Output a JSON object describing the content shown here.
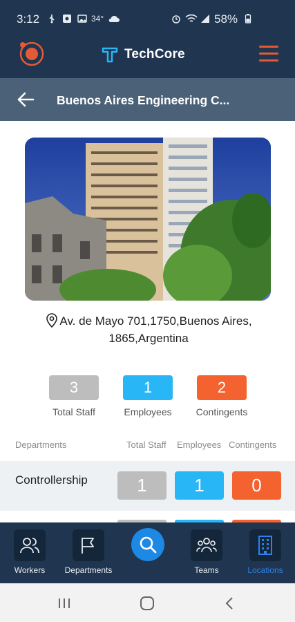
{
  "status_bar": {
    "time": "3:12",
    "temperature": "34°",
    "battery": "58%",
    "icons": [
      "usb-icon",
      "notification-icon",
      "image-icon",
      "cloud-icon",
      "alarm-icon",
      "wifi-icon",
      "signal-icon",
      "battery-icon"
    ]
  },
  "app": {
    "brand": "TechCore",
    "logo_icon": "orbit-logo-icon",
    "menu_icon": "hamburger-icon",
    "accent": "#e45a36",
    "navy": "#1f3550"
  },
  "header": {
    "back_icon": "arrow-left-icon",
    "title": "Buenos Aires Engineering C..."
  },
  "location": {
    "photo_alt": "building-photo",
    "address_line1": "Av. de Mayo 701,1750,Buenos Aires,",
    "address_line2": "1865,Argentina"
  },
  "summary": {
    "total_staff": {
      "value": "3",
      "label": "Total Staff",
      "color": "#bdbdbd"
    },
    "employees": {
      "value": "1",
      "label": "Employees",
      "color": "#29b6f6"
    },
    "contingents": {
      "value": "2",
      "label": "Contingents",
      "color": "#f4622f"
    }
  },
  "departments": {
    "headers": {
      "name": "Departments",
      "total": "Total Staff",
      "employees": "Employees",
      "contingents": "Contingents"
    },
    "rows": [
      {
        "name": "Controllership",
        "total": "1",
        "employees": "1",
        "contingents": "0"
      }
    ]
  },
  "bottom_nav": {
    "items": [
      {
        "label": "Workers",
        "icon": "people-icon"
      },
      {
        "label": "Departments",
        "icon": "flag-icon"
      },
      {
        "label": "",
        "icon": "search-icon"
      },
      {
        "label": "Teams",
        "icon": "team-icon"
      },
      {
        "label": "Locations",
        "icon": "building-icon",
        "active": true
      }
    ],
    "active_color": "#2f80ed"
  },
  "system_nav": {
    "icons": [
      "recents-icon",
      "home-icon",
      "back-icon"
    ]
  }
}
